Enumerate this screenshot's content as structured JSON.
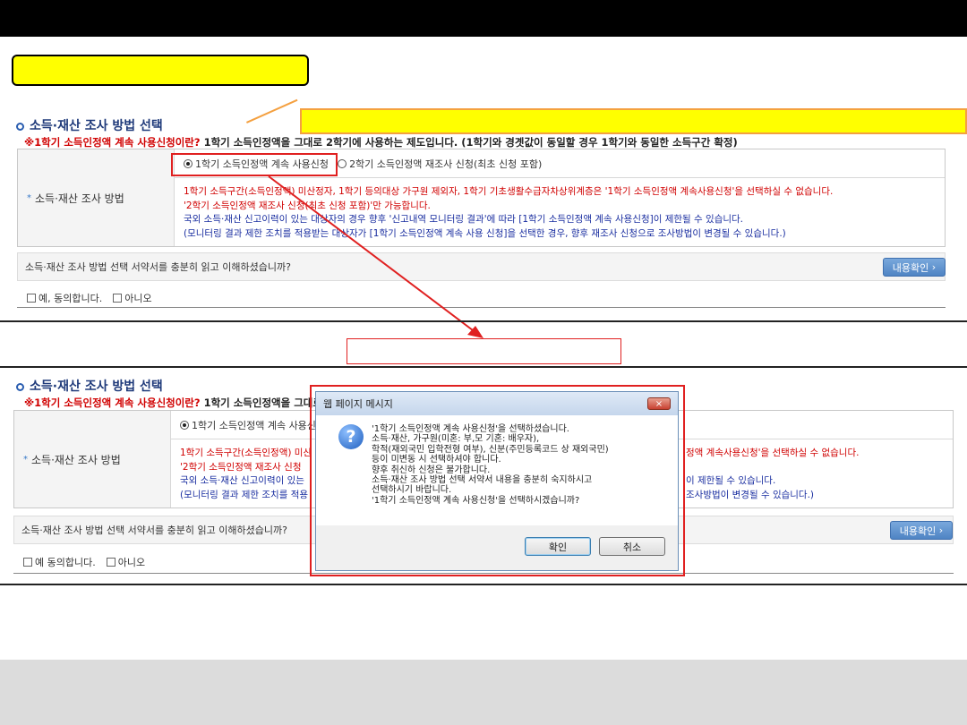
{
  "section": {
    "title": "소득·재산 조사 방법 선택",
    "notice_red": "※1학기 소득인정액 계속 사용신청이란?",
    "notice_rest": " 1학기 소득인정액을 그대로 2학기에 사용하는 제도입니다. (1학기와 경곗값이 동일할 경우 1학기와 동일한 소득구간 확정)",
    "notice_rest_short": " 1학기 소득인정액을 그대로"
  },
  "form": {
    "label": "소득·재산 조사 방법",
    "option1": "1학기 소득인정액 계속 사용신청",
    "option2": "2학기 소득인정액 재조사 신청(최초 신청 포함)",
    "desc": [
      "1학기 소득구간(소득인정액) 미산정자, 1학기 등의대상 가구원 제외자, 1학기 기초생활수급자차상위계층은 '1학기 소득인정액 계속사용신청'을 선택하실 수 없습니다.",
      "'2학기 소득인정액 재조사 신청(최초 신청 포함)'만 가능합니다.",
      "국외 소득·재산 신고이력이 있는 대상자의 경우 향후 '신고내역 모니터링 결과'에 따라 [1학기 소득인정액 계속 사용신청]이 제한될 수 있습니다.",
      "(모니터링 결과 제한 조치를 적용받는 대상자가 [1학기 소득인정액 계속 사용 신청]을 선택한 경우, 향후 재조사 신청으로 조사방법이 변경될 수 있습니다.)"
    ],
    "desc_bottom": [
      "1학기 소득구간(소득인정액) 미산",
      "'2학기 소득인정액 재조사 신청",
      "국외 소득·재산 신고이력이 있는",
      "(모니터링 결과 제한 조치를 적용"
    ],
    "desc_right": [
      "정액 계속사용신청'을 선택하실 수 없습니다.",
      "",
      "이 제한될 수 있습니다.",
      "조사방법이 변경될 수 있습니다.)"
    ],
    "agree_question": "소득·재산 조사 방법 선택 서약서를 충분히 읽고 이해하셨습니까?",
    "view_button": "내용확인",
    "yes_label": "예, 동의합니다.",
    "yes_label_bottom": "예 동의합니다.",
    "no_label": "아니오"
  },
  "dialog": {
    "title": "웹 페이지 메시지",
    "close": "×",
    "message": [
      "'1학기 소득인정액 계속 사용신청'을 선택하셨습니다.",
      "소득·재산, 가구원(미혼: 부,모 기혼: 배우자),",
      "학적(재외국민 입학전형 여부), 신분(주민등록코드 상 재외국민)",
      "등이 미변동 시 선택하셔야 합니다.",
      "향후 취신하 신청은 불가합니다.",
      "소득·재산 조사 방법 선택 서약서 내용을 충분히 숙지하시고",
      "선택하시기 바랍니다.",
      "'1학기 소득인정액 계속 사용신청'을 선택하시겠습니까?"
    ],
    "ok": "확인",
    "cancel": "취소"
  },
  "colors": {
    "callout": "#ffff00",
    "highlight": "#e02020",
    "accent": "#2a5db0"
  }
}
